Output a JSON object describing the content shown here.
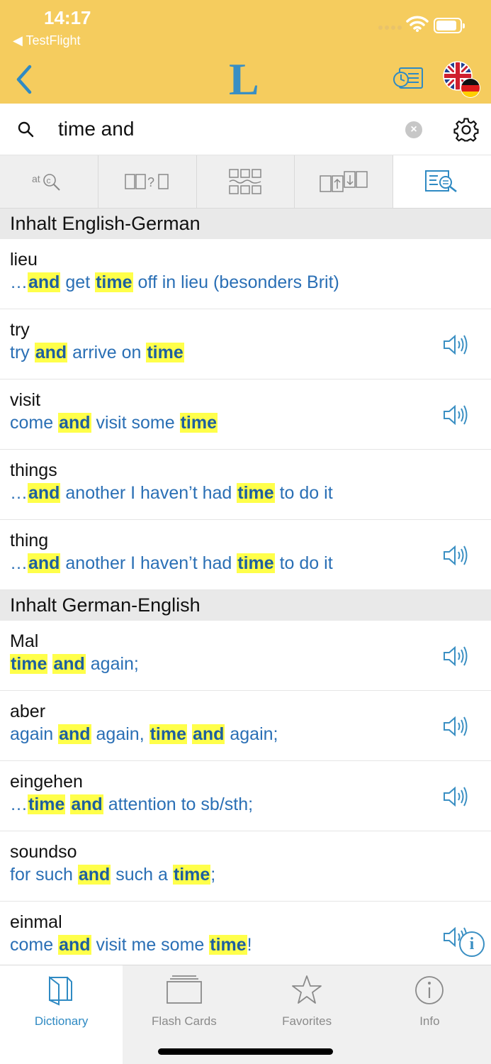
{
  "status": {
    "time": "14:17",
    "back_app": "◀ TestFlight"
  },
  "header": {
    "logo": "L"
  },
  "search": {
    "value": "time and",
    "clear_icon": "×"
  },
  "modes": [
    {
      "name": "spell-search"
    },
    {
      "name": "wildcard-search"
    },
    {
      "name": "crossword-search"
    },
    {
      "name": "reverse-search"
    },
    {
      "name": "fulltext-search",
      "active": true
    }
  ],
  "sections": [
    {
      "title": "Inhalt English-German",
      "entries": [
        {
          "headword": "lieu",
          "example": [
            [
              "…"
            ],
            [
              "and",
              1
            ],
            [
              " get "
            ],
            [
              "time",
              1
            ],
            [
              " off in lieu (besonders Brit)"
            ]
          ],
          "audio": false
        },
        {
          "headword": "try",
          "example": [
            [
              "try "
            ],
            [
              "and",
              1
            ],
            [
              " arrive on "
            ],
            [
              "time",
              1
            ]
          ],
          "audio": true
        },
        {
          "headword": "visit",
          "example": [
            [
              "come "
            ],
            [
              "and",
              1
            ],
            [
              " visit some "
            ],
            [
              "time",
              1
            ]
          ],
          "audio": true
        },
        {
          "headword": "things",
          "example": [
            [
              "…"
            ],
            [
              "and",
              1
            ],
            [
              " another I haven’t had "
            ],
            [
              "time",
              1
            ],
            [
              " to do it"
            ]
          ],
          "audio": false
        },
        {
          "headword": "thing",
          "example": [
            [
              "…"
            ],
            [
              "and",
              1
            ],
            [
              " another I haven’t had "
            ],
            [
              "time",
              1
            ],
            [
              " to do it"
            ]
          ],
          "audio": true
        }
      ]
    },
    {
      "title": "Inhalt German-English",
      "entries": [
        {
          "headword": "Mal",
          "example": [
            [
              "time",
              1
            ],
            [
              " "
            ],
            [
              "and",
              1
            ],
            [
              " again;"
            ]
          ],
          "audio": true
        },
        {
          "headword": "aber",
          "example": [
            [
              "again "
            ],
            [
              "and",
              1
            ],
            [
              " again, "
            ],
            [
              "time",
              1
            ],
            [
              " "
            ],
            [
              "and",
              1
            ],
            [
              " again;"
            ]
          ],
          "audio": true
        },
        {
          "headword": "eingehen",
          "example": [
            [
              "…"
            ],
            [
              "time",
              1
            ],
            [
              " "
            ],
            [
              "and",
              1
            ],
            [
              " attention to sb/sth;"
            ]
          ],
          "audio": true
        },
        {
          "headword": "soundso",
          "example": [
            [
              "for such "
            ],
            [
              "and",
              1
            ],
            [
              " such a "
            ],
            [
              "time",
              1
            ],
            [
              ";"
            ]
          ],
          "audio": false
        },
        {
          "headword": "einmal",
          "example": [
            [
              "come "
            ],
            [
              "and",
              1
            ],
            [
              " visit me some "
            ],
            [
              "time",
              1
            ],
            [
              "!"
            ]
          ],
          "audio": true
        }
      ]
    }
  ],
  "info_fab": "i",
  "tabs": [
    {
      "label": "Dictionary",
      "icon": "book-icon",
      "active": true
    },
    {
      "label": "Flash Cards",
      "icon": "cards-icon",
      "active": false
    },
    {
      "label": "Favorites",
      "icon": "star-icon",
      "active": false
    },
    {
      "label": "Info",
      "icon": "info-icon",
      "active": false
    }
  ],
  "colors": {
    "header": "#f5cc5e",
    "accent": "#2f8ac3",
    "highlight": "#ffff4a",
    "example_text": "#2a6fb5"
  }
}
